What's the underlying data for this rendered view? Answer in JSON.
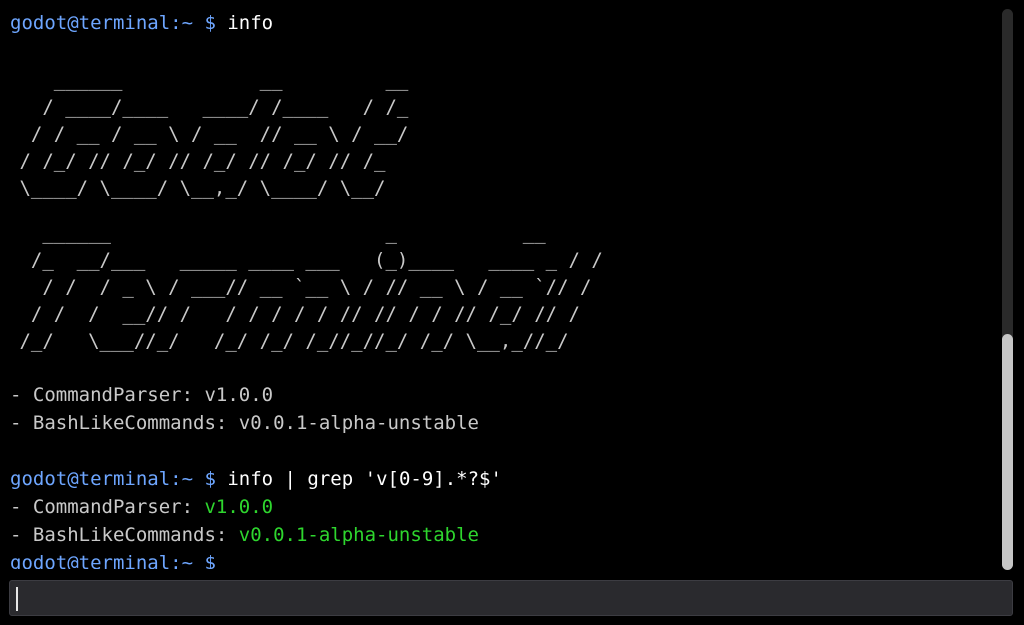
{
  "terminal": {
    "prompt": "godot@terminal:~ $",
    "command_1": "info",
    "ascii_logo": "    ______            __         __\n   / ____/____   ____/ /____   / /_\n  / / __ / __ \\ / __  // __ \\ / __/\n / /_/ // /_/ // /_/ // /_/ // /_\n \\____/ \\____/ \\__,_/ \\____/ \\__/",
    "ascii_title": "   ______                        _           __\n  /_  __/___   _____ ____ ___   (_)____   ____ _ / /\n   / /  / _ \\ / ___// __ `__ \\ / // __ \\ / __ `// /\n  / /  /  __// /   / / / / / // // / / // /_/ // /\n /_/   \\___//_/   /_/ /_/ /_//_//_/ /_/ \\__,_//_/",
    "info_lines": [
      {
        "label": "- CommandParser: ",
        "value": "v1.0.0"
      },
      {
        "label": "- BashLikeCommands: ",
        "value": "v0.0.1-alpha-unstable"
      }
    ],
    "command_2": "info | grep 'v[0-9].*?$'",
    "grep_lines": [
      {
        "label": "- CommandParser: ",
        "value": "v1.0.0"
      },
      {
        "label": "- BashLikeCommands: ",
        "value": "v0.0.1-alpha-unstable"
      }
    ]
  },
  "input": {
    "value": ""
  },
  "scrollbar": {
    "position": 0.58,
    "visible_fraction": 0.42
  },
  "colors": {
    "background": "#000000",
    "prompt": "#6ea6ff",
    "text": "#c9c9c9",
    "command": "#ffffff",
    "match": "#2ed62e",
    "input_background": "#2a2a2e"
  }
}
